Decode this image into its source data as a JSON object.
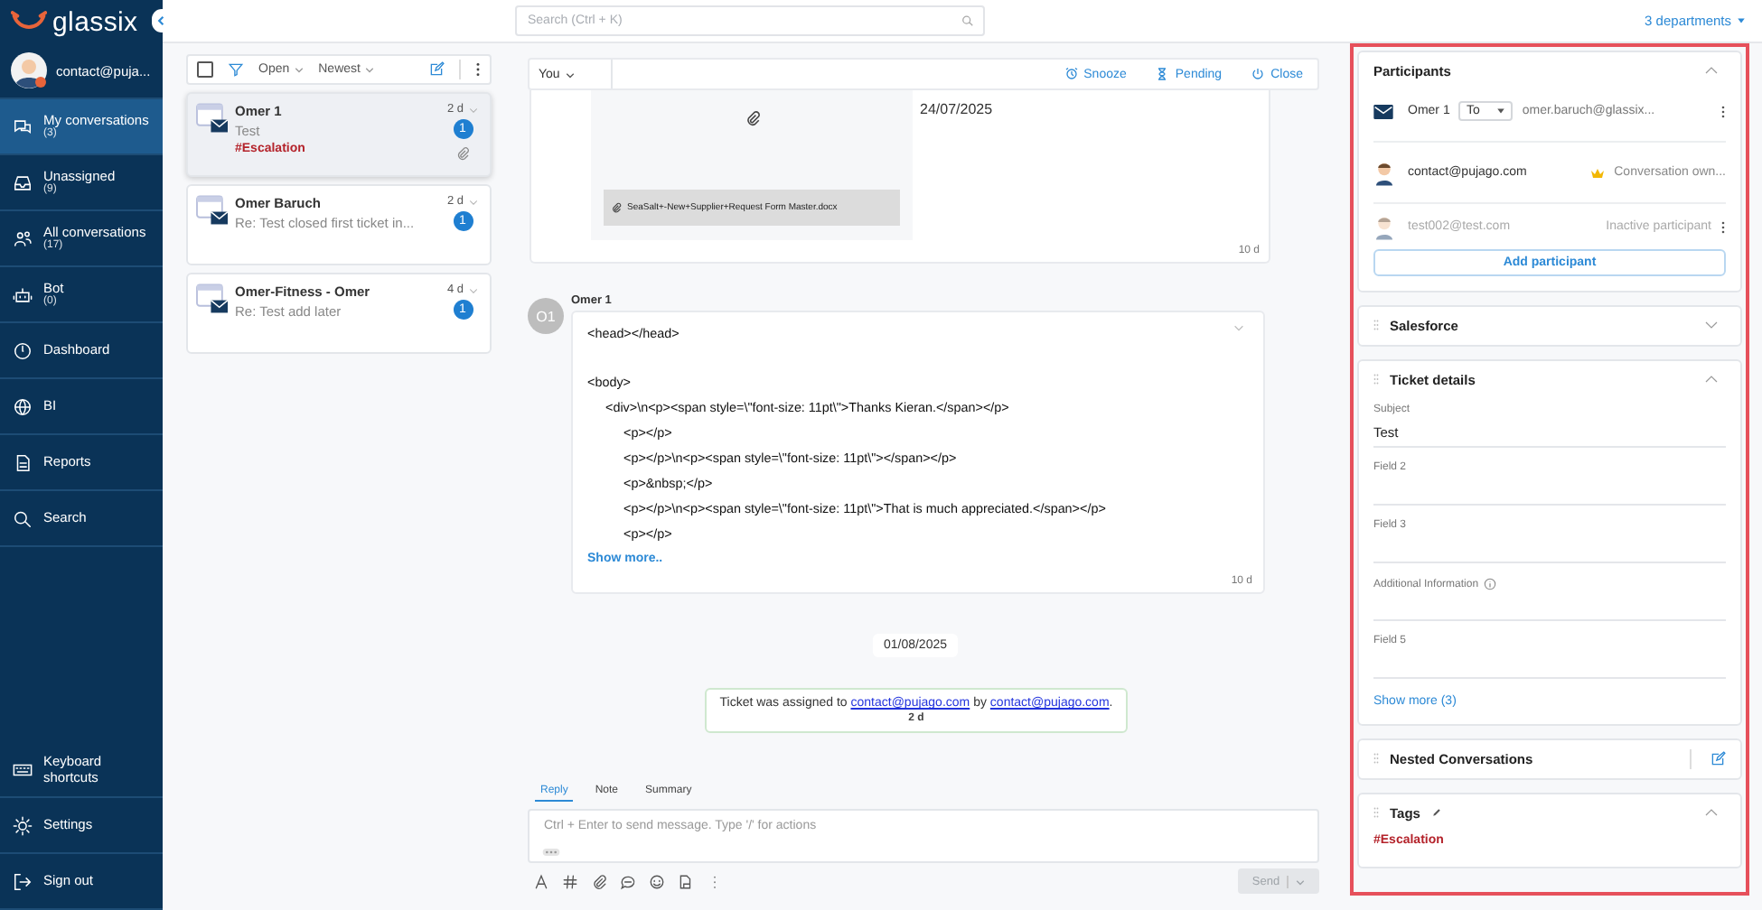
{
  "brand": {
    "name": "glassix"
  },
  "user": {
    "name": "contact@puja..."
  },
  "nav": [
    {
      "label": "My conversations",
      "count": "(3)",
      "selected": true
    },
    {
      "label": "Unassigned",
      "count": "(9)",
      "selected": false
    },
    {
      "label": "All conversations",
      "count": "(17)",
      "selected": false
    },
    {
      "label": "Bot",
      "count": "(0)",
      "selected": false
    },
    {
      "label": "Dashboard",
      "selected": false
    },
    {
      "label": "BI",
      "selected": false
    },
    {
      "label": "Reports",
      "selected": false
    },
    {
      "label": "Search",
      "selected": false
    }
  ],
  "footer_nav": [
    {
      "label": "Keyboard shortcuts"
    },
    {
      "label": "Settings"
    },
    {
      "label": "Sign out"
    }
  ],
  "search": {
    "placeholder": "Search (Ctrl + K)"
  },
  "departments": "3 departments",
  "list_toolbar": {
    "checked": false,
    "status": "Open",
    "sort": "Newest"
  },
  "conversations": [
    {
      "name": "Omer 1",
      "time": "2 d",
      "preview": "Test",
      "tag": "#Escalation",
      "unread": "1",
      "attachment": true,
      "selected": true
    },
    {
      "name": "Omer Baruch",
      "time": "2 d",
      "preview": "Re: Test closed first ticket in...",
      "unread": "1",
      "attachment": false,
      "selected": false
    },
    {
      "name": "Omer-Fitness - Omer",
      "time": "4 d",
      "preview": "Re: Test add later",
      "unread": "1",
      "attachment": false,
      "selected": false
    }
  ],
  "chat": {
    "assignee": "You",
    "actions": [
      {
        "label": "Snooze"
      },
      {
        "label": "Pending"
      },
      {
        "label": "Close"
      }
    ],
    "attachment_message": {
      "date": "24/07/2025",
      "file": "SeaSalt+-New+Supplier+Request Form Master.docx",
      "time": "10 d"
    },
    "message": {
      "initials": "O1",
      "sender": "Omer 1",
      "more": "Show more..",
      "time": "10 d",
      "blocks": [
        [
          {
            "text": "<head></head>"
          }
        ],
        [
          {
            "text": "<body>",
            "children": [
              {
                "text": "<div>\\n<p><span style=\\\"font-size: 11pt\\\">Thanks Kieran.</span></p>",
                "children": [
                  {
                    "text": "<p></p>"
                  },
                  {
                    "text": "<p></p>\\n<p><span style=\\\"font-size: 11pt\\\"></span></p>"
                  },
                  {
                    "text": "<p>&nbsp;</p>"
                  },
                  {
                    "text": "<p></p>\\n<p><span style=\\\"font-size: 11pt\\\">That is much appreciated.</span></p>"
                  },
                  {
                    "text": "<p></p>"
                  }
                ]
              }
            ]
          }
        ]
      ]
    },
    "date_separator": "01/08/2025",
    "system_note": {
      "parts": [
        {
          "text": "Ticket was assigned to ",
          "link": false
        },
        {
          "text": "contact@pujago.com",
          "link": true
        },
        {
          "text": " by ",
          "link": false
        },
        {
          "text": "contact@pujago.com",
          "link": true
        },
        {
          "text": ".",
          "link": false
        }
      ],
      "time": "2 d"
    }
  },
  "composer": {
    "tabs": [
      {
        "label": "Reply",
        "selected": true
      },
      {
        "label": "Note",
        "selected": false
      },
      {
        "label": "Summary",
        "selected": false
      }
    ],
    "placeholder": "Ctrl + Enter to send message. Type '/' for actions",
    "send": {
      "label": "Send",
      "disabled": true
    }
  },
  "panels": [
    {
      "kind": "participants",
      "title": "Participants",
      "expanded": true,
      "add": "Add participant",
      "rows": [
        {
          "kind": "email",
          "name": "Omer 1",
          "role": "To",
          "address": "omer.baruch@glassix...",
          "owner": false,
          "active": true,
          "menu": true
        },
        {
          "kind": "agent",
          "name": "contact@pujago.com",
          "status": "Conversation own...",
          "owner": true,
          "active": true,
          "menu": false
        },
        {
          "kind": "agent",
          "name": "test002@test.com",
          "status": "Inactive participant",
          "owner": false,
          "active": false,
          "menu": true
        }
      ]
    },
    {
      "kind": "section",
      "title": "Salesforce",
      "expanded": false
    },
    {
      "kind": "fields",
      "title": "Ticket details",
      "expanded": true,
      "more": "Show more (3)",
      "fields": [
        {
          "label": "Subject",
          "value": "Test",
          "info": false
        },
        {
          "label": "Field 2",
          "info": false
        },
        {
          "label": "Field 3",
          "info": false
        },
        {
          "label": "Additional Information",
          "info": true
        },
        {
          "label": "Field 5",
          "info": false
        }
      ]
    },
    {
      "kind": "nested",
      "title": "Nested Conversations"
    },
    {
      "kind": "tags",
      "title": "Tags",
      "expanded": true,
      "tags": [
        "#Escalation"
      ]
    }
  ]
}
